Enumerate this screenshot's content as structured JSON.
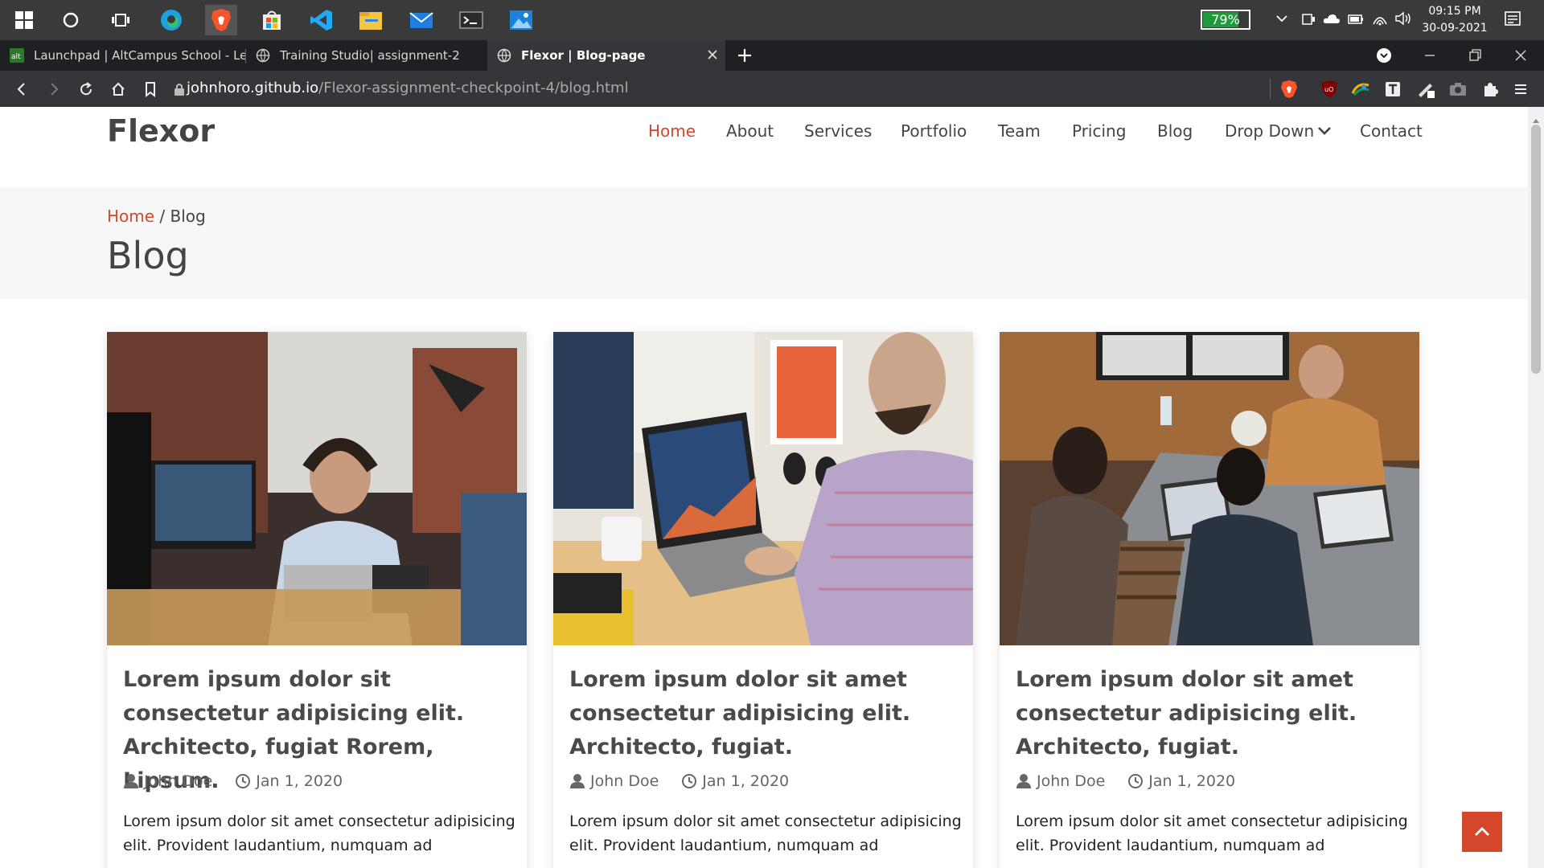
{
  "taskbar": {
    "battery_pct": "79%",
    "battery_level": 0.79,
    "time": "09:15 PM",
    "date": "30-09-2021",
    "icons": [
      "windows-start-icon",
      "search-circle-icon",
      "task-view-icon",
      "edge-icon",
      "brave-icon",
      "store-icon",
      "vscode-icon",
      "file-explorer-icon",
      "mail-icon",
      "terminal-icon",
      "photos-icon"
    ]
  },
  "tabs": [
    {
      "label": "Launchpad | AltCampus School - Learn"
    },
    {
      "label": "Training Studio| assignment-2"
    },
    {
      "label": "Flexor | Blog-page"
    }
  ],
  "address": {
    "domain": "johnhoro.github.io",
    "path": "/Flexor-assignment-checkpoint-4/blog.html"
  },
  "site": {
    "logo": "Flexor",
    "nav": [
      "Home",
      "About",
      "Services",
      "Portfolio",
      "Team",
      "Pricing",
      "Blog",
      "Drop Down",
      "Contact"
    ],
    "active_nav": "Home"
  },
  "breadcrumb": {
    "home": "Home",
    "sep": " / ",
    "current": "Blog"
  },
  "page_title": "Blog",
  "posts": [
    {
      "title": "Lorem ipsum dolor sit consectetur adipisicing elit. Architecto, fugiat Rorem, Lipsum.",
      "author": "John Doe",
      "date": "Jan 1, 2020",
      "excerpt": "Lorem ipsum dolor sit amet consectetur adipisicing elit. Provident laudantium, numquam ad"
    },
    {
      "title": "Lorem ipsum dolor sit amet consectetur adipisicing elit. Architecto, fugiat.",
      "author": "John Doe",
      "date": "Jan 1, 2020",
      "excerpt": "Lorem ipsum dolor sit amet consectetur adipisicing elit. Provident laudantium, numquam ad"
    },
    {
      "title": "Lorem ipsum dolor sit amet consectetur adipisicing elit. Architecto, fugiat.",
      "author": "John Doe",
      "date": "Jan 1, 2020",
      "excerpt": "Lorem ipsum dolor sit amet consectetur adipisicing elit. Provident laudantium, numquam ad"
    }
  ],
  "colors": {
    "accent": "#d4472d",
    "text": "#444444",
    "band": "#f7f7f7"
  }
}
